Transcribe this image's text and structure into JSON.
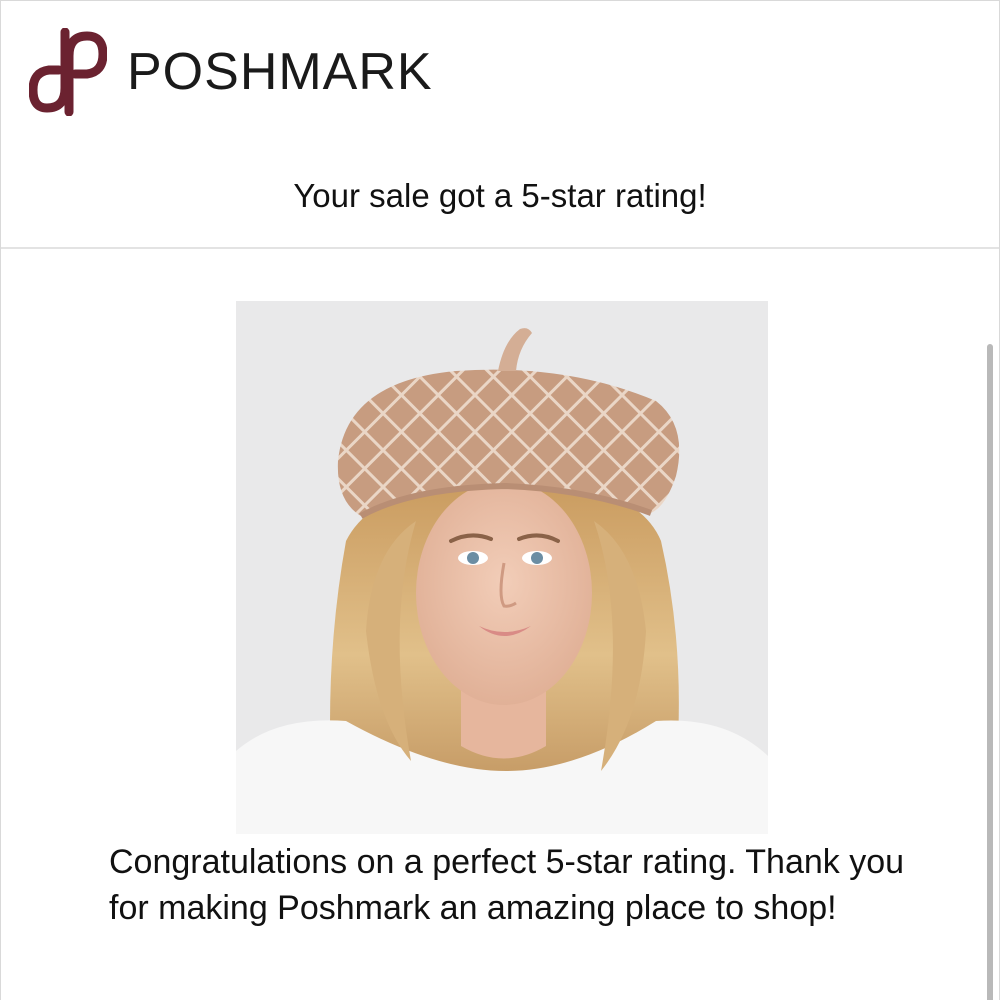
{
  "brand": {
    "name": "POSHMARK",
    "logo_icon": "poshmark-p-logo",
    "logo_color": "#6b2230"
  },
  "email": {
    "subject_line": "Your sale got a 5-star rating!",
    "message": "Congratulations on a perfect 5-star rating. Thank you for making Poshmark an amazing place to shop!"
  },
  "product_image": {
    "alt": "Woman wearing a tan knit beret with diamond pattern",
    "hat_color": "#c9a089",
    "hair_color": "#d8b47e",
    "background_color": "#e9e9ea"
  }
}
